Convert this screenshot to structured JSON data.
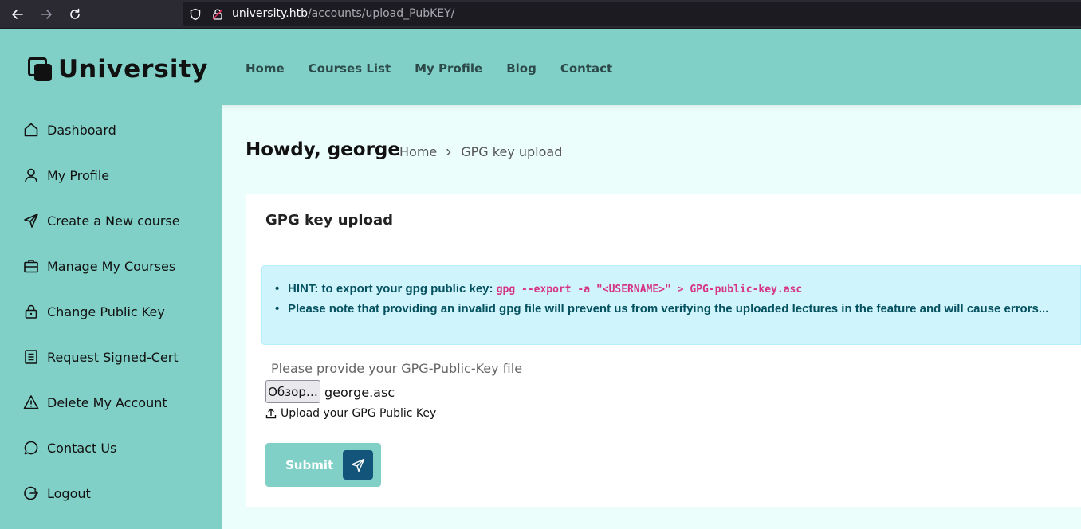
{
  "browser": {
    "url_host": "university.htb",
    "url_path": "/accounts/upload_PubKEY/"
  },
  "header": {
    "logo_text": "University",
    "nav": [
      "Home",
      "Courses List",
      "My Profile",
      "Blog",
      "Contact"
    ]
  },
  "sidebar": {
    "items": [
      {
        "label": "Dashboard",
        "icon": "home-icon"
      },
      {
        "label": "My Profile",
        "icon": "user-icon"
      },
      {
        "label": "Create a New course",
        "icon": "send-icon"
      },
      {
        "label": "Manage My Courses",
        "icon": "briefcase-icon"
      },
      {
        "label": "Change Public Key",
        "icon": "lock-icon"
      },
      {
        "label": "Request Signed-Cert",
        "icon": "document-icon"
      },
      {
        "label": "Delete My Account",
        "icon": "warning-icon"
      },
      {
        "label": "Contact Us",
        "icon": "chat-icon"
      },
      {
        "label": "Logout",
        "icon": "logout-icon"
      }
    ]
  },
  "main": {
    "greeting": "Howdy, george",
    "breadcrumb": [
      "Home",
      "GPG key upload"
    ],
    "card_title": "GPG key upload",
    "hints": [
      {
        "text": "HINT: to export your gpg public key: ",
        "code": "gpg --export -a \"<USERNAME>\" > GPG-public-key.asc"
      },
      {
        "text": "Please note that providing an invalid gpg file will prevent us from verifying the uploaded lectures in the feature and will cause errors...",
        "code": ""
      }
    ],
    "file_label": "Please provide your GPG-Public-Key file",
    "browse_label": "Обзор…",
    "file_name": "george.asc",
    "upload_hint": "Upload your GPG Public Key",
    "submit_label": "Submit"
  },
  "colors": {
    "teal": "#80d0c7",
    "dark_blue": "#13547a",
    "hint_bg": "#cff4fc",
    "hint_text": "#055160",
    "code": "#d63384"
  }
}
